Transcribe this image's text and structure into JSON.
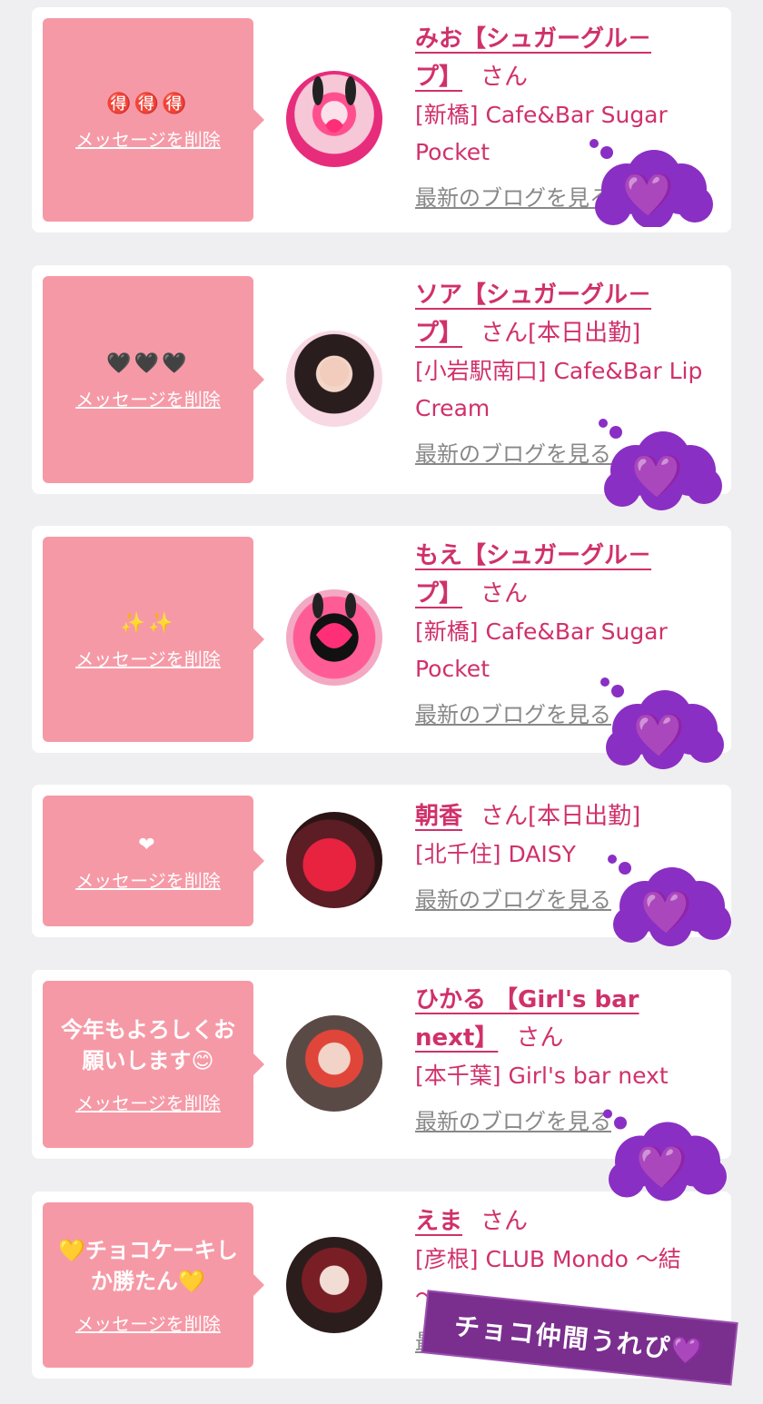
{
  "delete_label": "メッセージを削除",
  "blog_label": "最新のブログを見る",
  "san": "さん",
  "cards": [
    {
      "message": "🉐🉐🉐",
      "name": "みお【シュガーグループ】",
      "name_line1": "みお【シュガーグル－",
      "name_line2": "プ】",
      "today": "",
      "shop_line1": "[新橋] Cafe&Bar Sugar",
      "shop_line2": "Pocket"
    },
    {
      "message": "🖤🖤🖤",
      "name_line1": "ソア【シュガーグル－",
      "name_line2": "プ】",
      "today": "[本日出勤]",
      "shop_line1": "[小岩駅南口] Cafe&Bar Lip",
      "shop_line2": "Cream"
    },
    {
      "message": "✨✨",
      "name_line1": "もえ【シュガーグル－",
      "name_line2": "プ】",
      "today": "",
      "shop_line1": "[新橋] Cafe&Bar Sugar",
      "shop_line2": "Pocket"
    },
    {
      "message": "❤",
      "name_line1": "朝香",
      "today": "[本日出勤]",
      "shop_line1": "[北千住] DAISY"
    },
    {
      "message_line1": "今年もよろしくお",
      "message_line2": "願いします😊",
      "name_line1": "ひかる 【Girl's bar",
      "name_line2": "next】",
      "shop_line1": "[本千葉] Girl's bar next"
    },
    {
      "message_line1": "💛チョコケーキし",
      "message_line2": "か勝たん💛",
      "name_line1": "えま",
      "shop_line1": "[彦根] CLUB Mondo ～結",
      "shop_line2": "～"
    }
  ],
  "sticker_text": "チョコ仲間うれぴ💜",
  "colors": {
    "pink_bubble": "#f699a6",
    "name_pink": "#d0316a",
    "cloud_purple": "#8a2fc4"
  }
}
